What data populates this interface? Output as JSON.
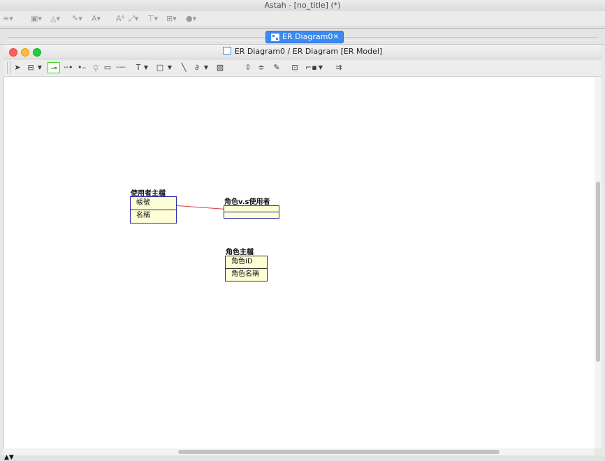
{
  "app": {
    "title": "Astah - [no_title] (*)"
  },
  "tab": {
    "label": "ER Diagram0",
    "close": "×"
  },
  "window": {
    "title": "ER Diagram0 / ER Diagram [ER Model]"
  },
  "draw_toolbar": {
    "text_tool": "T",
    "dropdown": "▼"
  },
  "canvas": {
    "entities": [
      {
        "name": "使用者主檔",
        "attributes": [
          "帳號",
          "名稱"
        ]
      },
      {
        "name": "角色v.s使用者",
        "attributes": []
      },
      {
        "name": "角色主檔",
        "attributes": [
          "角色ID",
          "角色名稱"
        ]
      }
    ],
    "relationship_color": "#d63a3a"
  },
  "colors": {
    "tab_active": "#3b8af2",
    "entity_fill": "#fdfdd6",
    "entity_border": "#2b2bb0"
  }
}
